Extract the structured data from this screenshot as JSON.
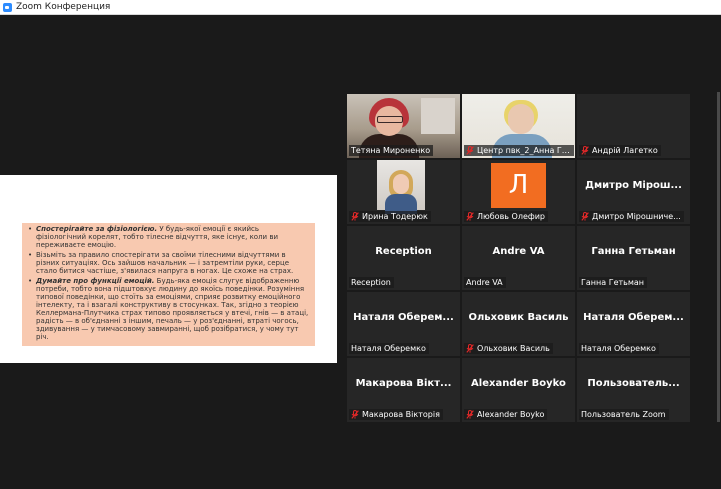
{
  "window": {
    "title": "Zoom Конференция"
  },
  "slide": {
    "items": [
      {
        "lead": "Спостерігайте за фізіологією.",
        "text": " У будь-якої емоції є якийсь фізіологічний корелят, тобто тілесне відчуття, яке існує, коли ви переживаєте емоцію."
      },
      {
        "lead": "",
        "text": "Візьміть за правило спостерігати за своїми тілесними відчуттями в різних ситуаціях. Ось зайшов начальник — і затремтіли руки, серце стало битися частіше, з'явилася напруга в ногах. Це схоже на страх."
      },
      {
        "lead": "Думайте про функції емоцій.",
        "text": " Будь-яка емоція слугує відображенню потреби, тобто вона підштовхує людину до якоїсь поведінки. Розуміння типової поведінки, що стоїть за емоціями, сприяє розвитку емоційного інтелекту, та і взагалі конструктиву в стосунках. Так, згідно з теорією Келлермана-Плутчика страх типово проявляється у втечі, гнів — в атаці, радість — в об'єднанні з іншим, печаль — у роз'єднанні, втраті чогось, здивування — у тимчасовому завмиранні, щоб розібратися, у чому тут річ."
      }
    ]
  },
  "participants": [
    {
      "label": "Тетяна Мироненко",
      "center": "",
      "muted": false,
      "active": true,
      "video": "tetyana"
    },
    {
      "label": "Центр пвк_2_Анна Гл...",
      "center": "",
      "muted": true,
      "active": false,
      "video": "anna"
    },
    {
      "label": "Андрій Лагетко",
      "center": "",
      "muted": true,
      "active": false,
      "video": ""
    },
    {
      "label": "Ирина Тодерюк",
      "center": "",
      "muted": true,
      "active": false,
      "video": "iryna"
    },
    {
      "label": "Любовь Олефир",
      "center": "",
      "muted": true,
      "active": false,
      "video": "avatar",
      "avatar_letter": "Л"
    },
    {
      "label": "Дмитро Мірошниче...",
      "center": "Дмитро Мірош...",
      "muted": true,
      "active": false,
      "video": ""
    },
    {
      "label": "Reception",
      "center": "Reception",
      "muted": false,
      "active": false,
      "video": ""
    },
    {
      "label": "Andre VA",
      "center": "Andre VA",
      "muted": false,
      "active": false,
      "video": ""
    },
    {
      "label": "Ганна Гетьман",
      "center": "Ганна Гетьман",
      "muted": false,
      "active": false,
      "video": ""
    },
    {
      "label": "Наталя Оберемко",
      "center": "Наталя  Оберем...",
      "muted": false,
      "active": false,
      "video": ""
    },
    {
      "label": "Ольховик Василь",
      "center": "Ольховик Василь",
      "muted": true,
      "active": false,
      "video": ""
    },
    {
      "label": "Наталя Оберемко",
      "center": "Наталя  Оберем...",
      "muted": false,
      "active": false,
      "video": ""
    },
    {
      "label": "Макарова Вікторія",
      "center": "Макарова  Вікт...",
      "muted": true,
      "active": false,
      "video": ""
    },
    {
      "label": "Alexander Boyko",
      "center": "Alexander Boyko",
      "muted": true,
      "active": false,
      "video": ""
    },
    {
      "label": "Пользователь Zoom",
      "center": "Пользователь...",
      "muted": false,
      "active": false,
      "video": ""
    }
  ],
  "colors": {
    "active_outline": "#c8f04b",
    "mute_red": "#e02828",
    "avatar_orange": "#f26d21"
  }
}
